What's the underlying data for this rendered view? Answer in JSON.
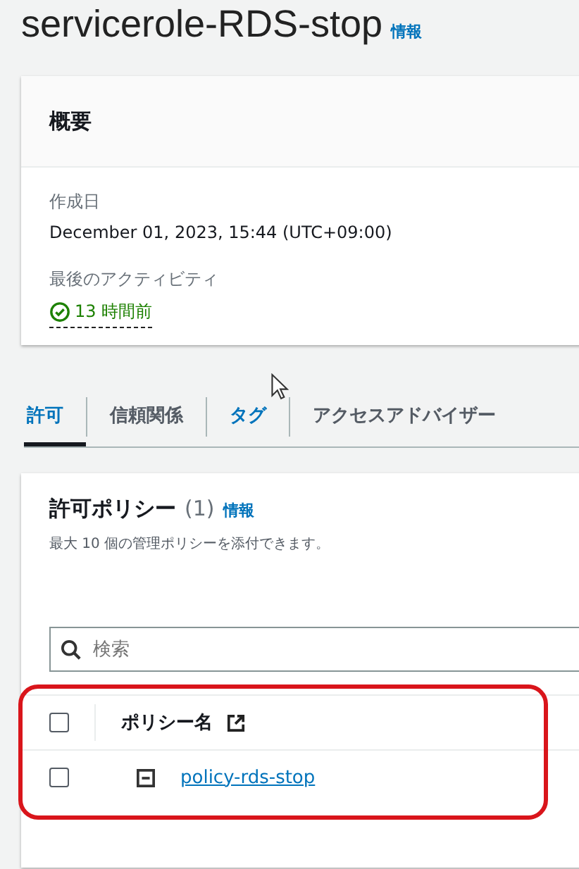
{
  "header": {
    "title": "servicerole-RDS-stop",
    "info_link": "情報"
  },
  "overview": {
    "title": "概要",
    "fields": [
      {
        "label": "作成日",
        "value": "December 01, 2023, 15:44 (UTC+09:00)",
        "kind": "text"
      },
      {
        "label": "最後のアクティビティ",
        "value": "13 時間前",
        "kind": "status"
      }
    ]
  },
  "tabs": [
    {
      "label": "許可",
      "selected": true,
      "highlighted": false
    },
    {
      "label": "信頼関係",
      "selected": false,
      "highlighted": false
    },
    {
      "label": "タグ",
      "selected": false,
      "highlighted": true
    },
    {
      "label": "アクセスアドバイザー",
      "selected": false,
      "highlighted": false
    }
  ],
  "policies": {
    "title": "許可ポリシー",
    "count": "(1)",
    "info_link": "情報",
    "description": "最大 10 個の管理ポリシーを添付できます。",
    "search": {
      "placeholder": "検索"
    },
    "table": {
      "columns": [
        "ポリシー名"
      ],
      "header_checked": false,
      "rows": [
        {
          "name": "policy-rds-stop",
          "checked": false,
          "expanded": false
        }
      ]
    }
  }
}
